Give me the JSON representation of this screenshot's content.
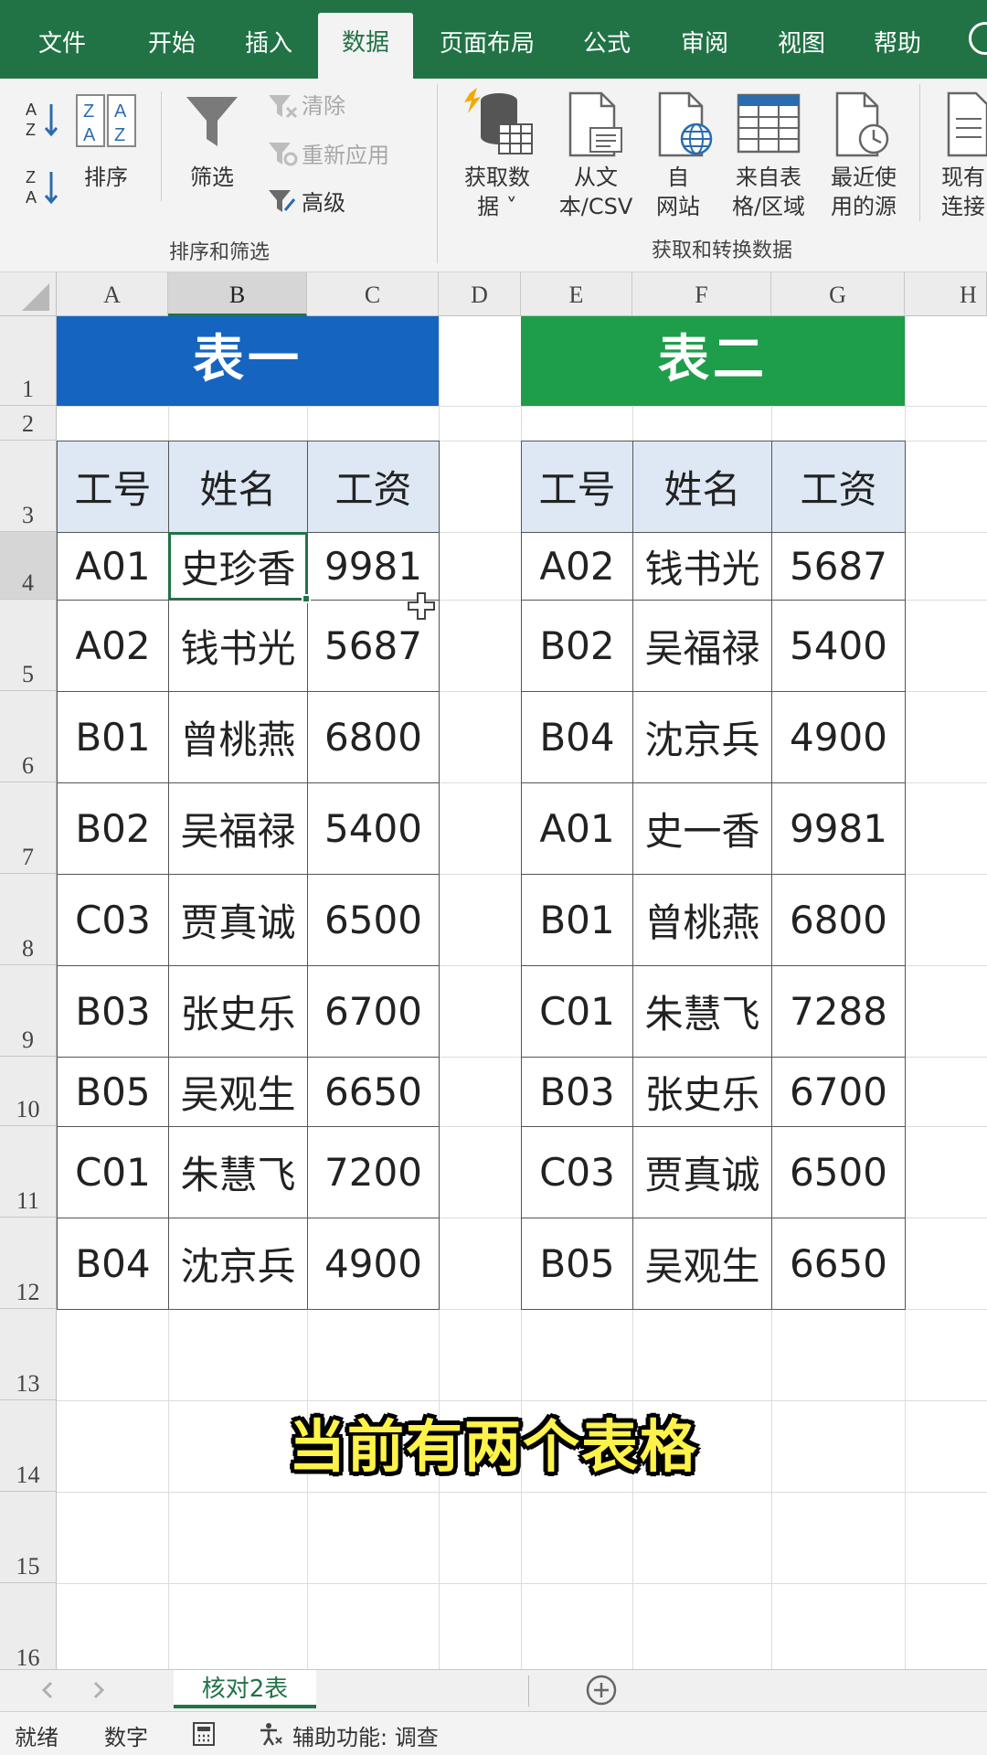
{
  "ribbon_tabs": [
    "文件",
    "开始",
    "插入",
    "数据",
    "页面布局",
    "公式",
    "审阅",
    "视图",
    "帮助"
  ],
  "active_tab": "数据",
  "ribbon": {
    "sort_label": "排序",
    "filter_label": "筛选",
    "clear_label": "清除",
    "reapply_label": "重新应用",
    "advanced_label": "高级",
    "group_sort_filter": "排序和筛选",
    "get_data_line1": "获取数",
    "get_data_line2": "据 ˅",
    "from_text_line1": "从文",
    "from_text_line2": "本/CSV",
    "from_web_line1": "自",
    "from_web_line2": "网站",
    "from_table_line1": "来自表",
    "from_table_line2": "格/区域",
    "recent_line1": "最近使",
    "recent_line2": "用的源",
    "existing_line1": "现有",
    "existing_line2": "连接",
    "group_get_transform": "获取和转换数据"
  },
  "grid": {
    "columns": [
      "A",
      "B",
      "C",
      "D",
      "E",
      "F",
      "G",
      "H"
    ],
    "rows": [
      "1",
      "2",
      "3",
      "4",
      "5",
      "6",
      "7",
      "8",
      "9",
      "10",
      "11",
      "12",
      "13",
      "14",
      "15",
      "16"
    ],
    "selected_column": "B",
    "selected_row": "4"
  },
  "table1": {
    "title": "表一",
    "title_color": "#1565c0",
    "headers": [
      "工号",
      "姓名",
      "工资"
    ],
    "rows": [
      [
        "A01",
        "史珍香",
        "9981"
      ],
      [
        "A02",
        "钱书光",
        "5687"
      ],
      [
        "B01",
        "曾桃燕",
        "6800"
      ],
      [
        "B02",
        "吴福禄",
        "5400"
      ],
      [
        "C03",
        "贾真诚",
        "6500"
      ],
      [
        "B03",
        "张史乐",
        "6700"
      ],
      [
        "B05",
        "吴观生",
        "6650"
      ],
      [
        "C01",
        "朱慧飞",
        "7200"
      ],
      [
        "B04",
        "沈京兵",
        "4900"
      ]
    ]
  },
  "table2": {
    "title": "表二",
    "title_color": "#1e9e4a",
    "headers": [
      "工号",
      "姓名",
      "工资"
    ],
    "rows": [
      [
        "A02",
        "钱书光",
        "5687"
      ],
      [
        "B02",
        "吴福禄",
        "5400"
      ],
      [
        "B04",
        "沈京兵",
        "4900"
      ],
      [
        "A01",
        "史一香",
        "9981"
      ],
      [
        "B01",
        "曾桃燕",
        "6800"
      ],
      [
        "C01",
        "朱慧飞",
        "7288"
      ],
      [
        "B03",
        "张史乐",
        "6700"
      ],
      [
        "C03",
        "贾真诚",
        "6500"
      ],
      [
        "B05",
        "吴观生",
        "6650"
      ]
    ]
  },
  "caption": "当前有两个表格",
  "sheet_tab": "核对2表",
  "add_sheet_icon": "plus-circle-icon",
  "status": {
    "ready": "就绪",
    "numeric": "数字",
    "accessibility": "辅助功能: 调查"
  },
  "colors": {
    "excel_green": "#217346",
    "header_fill": "#dde8f4",
    "caption_yellow": "#fff34a"
  }
}
